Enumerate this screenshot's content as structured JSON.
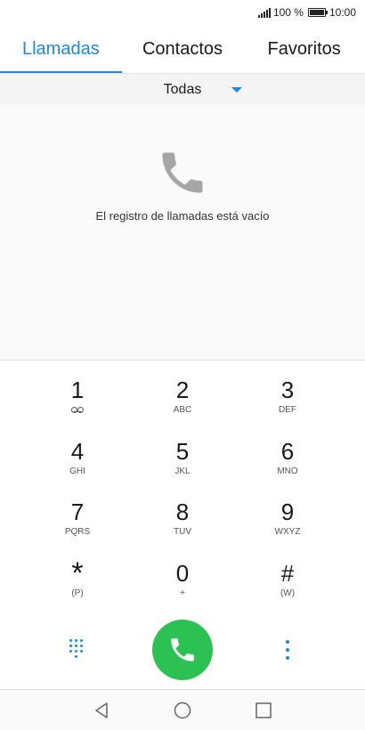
{
  "status_bar": {
    "battery_text": "100 %",
    "time": "10:00"
  },
  "tabs": [
    {
      "label": "Llamadas",
      "active": true
    },
    {
      "label": "Contactos",
      "active": false
    },
    {
      "label": "Favoritos",
      "active": false
    }
  ],
  "filter": {
    "selected": "Todas"
  },
  "empty_state": {
    "message": "El registro de llamadas está vacío",
    "icon": "phone-icon"
  },
  "dialpad": {
    "keys": [
      {
        "digit": "1",
        "sub": "",
        "icon": "voicemail-icon"
      },
      {
        "digit": "2",
        "sub": "ABC"
      },
      {
        "digit": "3",
        "sub": "DEF"
      },
      {
        "digit": "4",
        "sub": "GHI"
      },
      {
        "digit": "5",
        "sub": "JKL"
      },
      {
        "digit": "6",
        "sub": "MNO"
      },
      {
        "digit": "7",
        "sub": "PQRS"
      },
      {
        "digit": "8",
        "sub": "TUV"
      },
      {
        "digit": "9",
        "sub": "WXYZ"
      },
      {
        "digit": "*",
        "sub": "(P)"
      },
      {
        "digit": "0",
        "sub": "+"
      },
      {
        "digit": "#",
        "sub": "(W)"
      }
    ]
  },
  "actions": {
    "left_icon": "dialpad-grid-icon",
    "call_icon": "call-icon",
    "right_icon": "more-options-icon"
  },
  "colors": {
    "accent": "#1e88e5",
    "call_green": "#2bc253"
  }
}
